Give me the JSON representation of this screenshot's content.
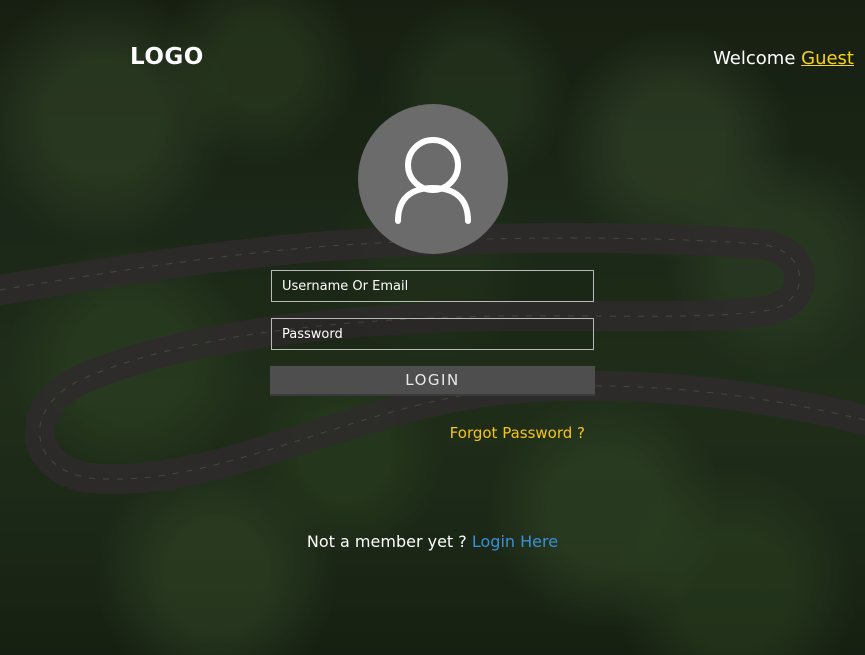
{
  "header": {
    "logo_text": "LOGO",
    "welcome_text": "Welcome ",
    "guest_link": "Guest"
  },
  "form": {
    "username_placeholder": "Username Or Email",
    "password_placeholder": "Password",
    "login_button": "LOGIN",
    "forgot_password": "Forgot Password ?"
  },
  "footer": {
    "member_text": "Not a member yet ? ",
    "login_here_link": "Login Here"
  },
  "icons": {
    "avatar": "user-icon"
  },
  "colors": {
    "accent_yellow": "#f5d320",
    "link_blue": "#3a8fd6",
    "button_bg": "#4e4e4e",
    "avatar_bg": "#6b6b6b"
  }
}
